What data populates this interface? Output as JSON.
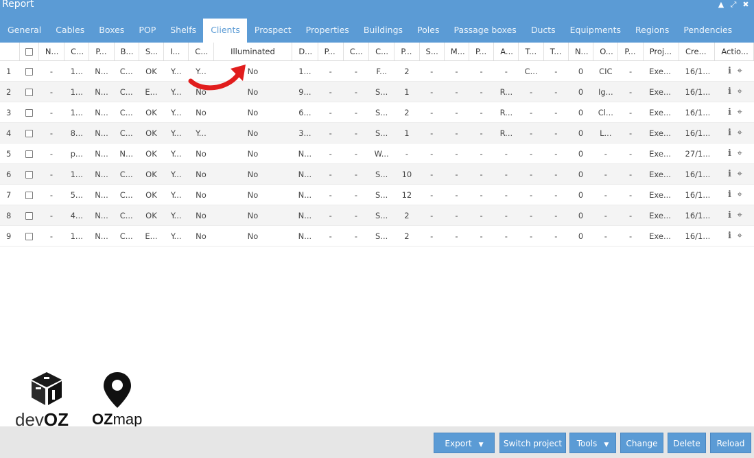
{
  "window": {
    "title": "Report"
  },
  "tabs": [
    "General",
    "Cables",
    "Boxes",
    "POP",
    "Shelfs",
    "Clients",
    "Prospect",
    "Properties",
    "Buildings",
    "Poles",
    "Passage boxes",
    "Ducts",
    "Equipments",
    "Regions",
    "Pendencies"
  ],
  "active_tab": "Clients",
  "table": {
    "headers": [
      "N...",
      "C...",
      "P...",
      "B...",
      "S...",
      "I...",
      "C...",
      "Illuminated",
      "D...",
      "P...",
      "C...",
      "C...",
      "P...",
      "S...",
      "M...",
      "P...",
      "A...",
      "T...",
      "T...",
      "N...",
      "O...",
      "P...",
      "Proj...",
      "Cre...",
      "Actio..."
    ],
    "rows": [
      [
        "1",
        "-",
        "1...",
        "N...",
        "C...",
        "OK",
        "Y...",
        "Y...",
        "No",
        "1...",
        "-",
        "-",
        "F...",
        "2",
        "-",
        "-",
        "-",
        "-",
        "C...",
        "-",
        "0",
        "CIC",
        "-",
        "Exe...",
        "16/1..."
      ],
      [
        "2",
        "-",
        "1...",
        "N...",
        "C...",
        "E...",
        "Y...",
        "No",
        "No",
        "9...",
        "-",
        "-",
        "S...",
        "1",
        "-",
        "-",
        "-",
        "R...",
        "-",
        "-",
        "0",
        "Ig...",
        "-",
        "Exe...",
        "16/1..."
      ],
      [
        "3",
        "-",
        "1...",
        "N...",
        "C...",
        "OK",
        "Y...",
        "No",
        "No",
        "6...",
        "-",
        "-",
        "S...",
        "2",
        "-",
        "-",
        "-",
        "R...",
        "-",
        "-",
        "0",
        "Cl...",
        "-",
        "Exe...",
        "16/1..."
      ],
      [
        "4",
        "-",
        "8...",
        "N...",
        "C...",
        "OK",
        "Y...",
        "Y...",
        "No",
        "3...",
        "-",
        "-",
        "S...",
        "1",
        "-",
        "-",
        "-",
        "R...",
        "-",
        "-",
        "0",
        "L...",
        "-",
        "Exe...",
        "16/1..."
      ],
      [
        "5",
        "-",
        "p...",
        "N...",
        "N...",
        "OK",
        "Y...",
        "No",
        "No",
        "N...",
        "-",
        "-",
        "W...",
        "-",
        "-",
        "-",
        "-",
        "-",
        "-",
        "-",
        "0",
        "-",
        "-",
        "Exe...",
        "27/1..."
      ],
      [
        "6",
        "-",
        "1...",
        "N...",
        "C...",
        "OK",
        "Y...",
        "No",
        "No",
        "N...",
        "-",
        "-",
        "S...",
        "10",
        "-",
        "-",
        "-",
        "-",
        "-",
        "-",
        "0",
        "-",
        "-",
        "Exe...",
        "16/1..."
      ],
      [
        "7",
        "-",
        "5...",
        "N...",
        "C...",
        "OK",
        "Y...",
        "No",
        "No",
        "N...",
        "-",
        "-",
        "S...",
        "12",
        "-",
        "-",
        "-",
        "-",
        "-",
        "-",
        "0",
        "-",
        "-",
        "Exe...",
        "16/1..."
      ],
      [
        "8",
        "-",
        "4...",
        "N...",
        "C...",
        "OK",
        "Y...",
        "No",
        "No",
        "N...",
        "-",
        "-",
        "S...",
        "2",
        "-",
        "-",
        "-",
        "-",
        "-",
        "-",
        "0",
        "-",
        "-",
        "Exe...",
        "16/1..."
      ],
      [
        "9",
        "-",
        "1...",
        "N...",
        "C...",
        "E...",
        "Y...",
        "No",
        "No",
        "N...",
        "-",
        "-",
        "S...",
        "2",
        "-",
        "-",
        "-",
        "-",
        "-",
        "-",
        "0",
        "-",
        "-",
        "Exe...",
        "16/1..."
      ]
    ]
  },
  "logos": {
    "devoz_pre": "dev",
    "devoz_bold": "OZ",
    "ozmap_bold": "OZ",
    "ozmap_rest": "map"
  },
  "footer": {
    "export": "Export",
    "switch_project": "Switch project",
    "tools": "Tools",
    "change": "Change",
    "delete": "Delete",
    "reload": "Reload"
  },
  "colors": {
    "accent": "#5b9bd5",
    "arrow": "#e11d1d"
  }
}
